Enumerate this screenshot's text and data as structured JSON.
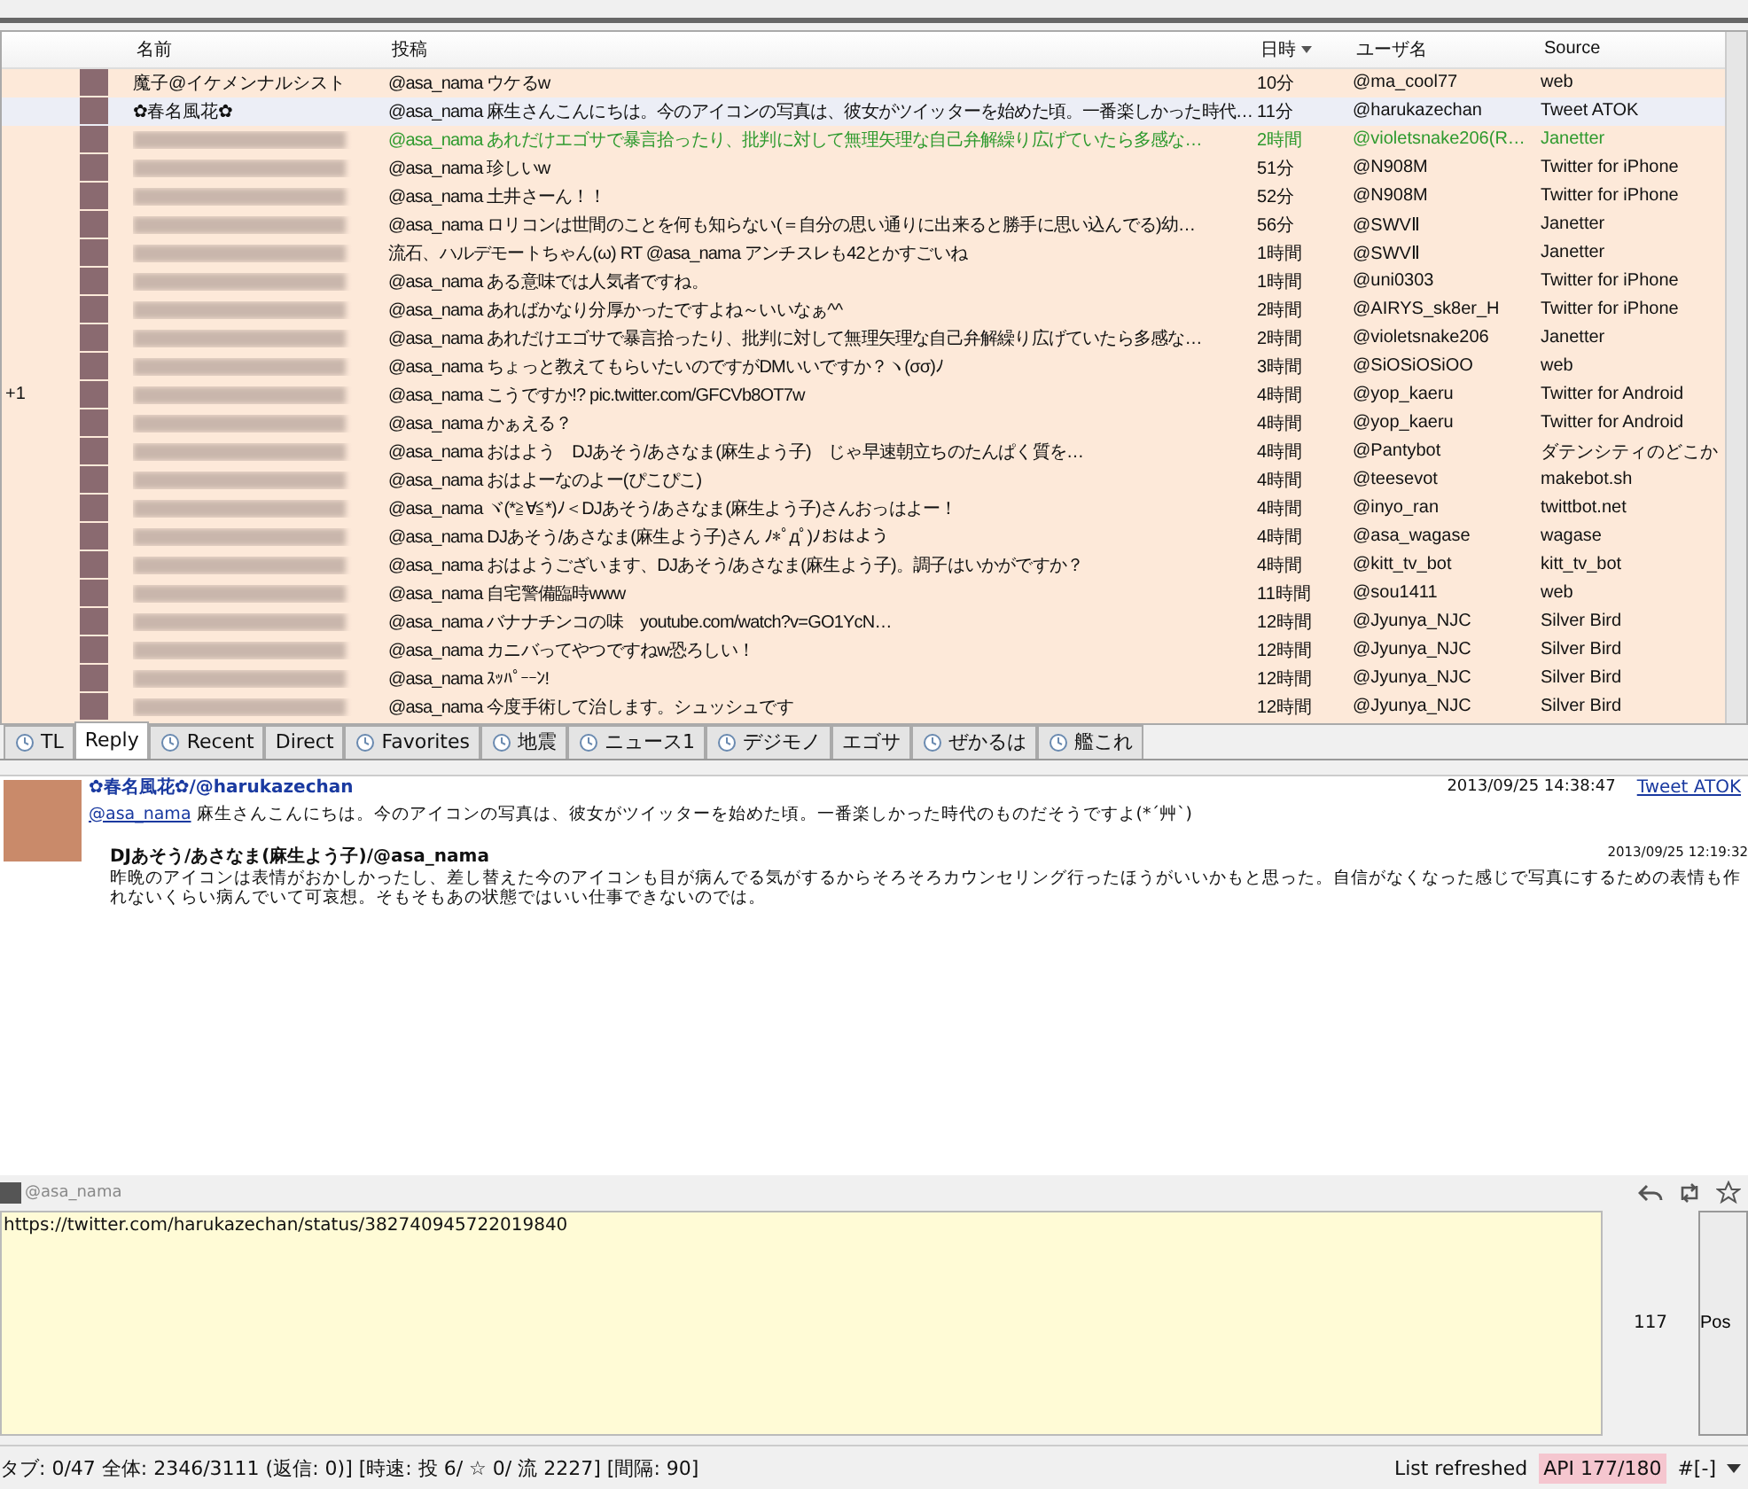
{
  "table": {
    "columns": [
      {
        "label": "名前",
        "sort": false
      },
      {
        "label": "投稿",
        "sort": false
      },
      {
        "label": "日時",
        "sort": true
      },
      {
        "label": "ユーザ名",
        "sort": false
      },
      {
        "label": "Source",
        "sort": false
      }
    ],
    "rows": [
      {
        "mark": "",
        "name": "魔子@イケメンナルシスト",
        "post": "@asa_nama ウケるw",
        "time": "10分",
        "user": "@ma_cool77",
        "source": "web",
        "selected": false,
        "green": false
      },
      {
        "mark": "",
        "name": "✿春名風花✿",
        "post": "@asa_nama 麻生さんこんにちは。今のアイコンの写真は、彼女がツイッターを始めた頃。一番楽しかった時代…",
        "time": "11分",
        "user": "@harukazechan",
        "source": "Tweet ATOK",
        "selected": true,
        "green": false
      },
      {
        "mark": "",
        "post": "@asa_nama あれだけエゴサで暴言拾ったり、批判に対して無理矢理な自己弁解繰り広げていたら多感な…",
        "time": "2時間",
        "user": "@violetsnake206(R…",
        "source": "Janetter",
        "selected": false,
        "green": true
      },
      {
        "mark": "",
        "post": "@asa_nama 珍しいw",
        "time": "51分",
        "user": "@N908M",
        "source": "Twitter for iPhone",
        "selected": false,
        "green": false
      },
      {
        "mark": "",
        "post": "@asa_nama 土井さーん！！",
        "time": "52分",
        "user": "@N908M",
        "source": "Twitter for iPhone",
        "selected": false,
        "green": false
      },
      {
        "mark": "",
        "post": "@asa_nama ロリコンは世間のことを何も知らない(＝自分の思い通りに出来ると勝手に思い込んでる)幼…",
        "time": "56分",
        "user": "@SWVⅡ",
        "source": "Janetter",
        "selected": false,
        "green": false
      },
      {
        "mark": "",
        "post": "流石、ハルデモートちゃん(ω) RT @asa_nama アンチスレも42とかすごいね",
        "time": "1時間",
        "user": "@SWVⅡ",
        "source": "Janetter",
        "selected": false,
        "green": false
      },
      {
        "mark": "",
        "post": "@asa_nama ある意味では人気者ですね。",
        "time": "1時間",
        "user": "@uni0303",
        "source": "Twitter for iPhone",
        "selected": false,
        "green": false
      },
      {
        "mark": "",
        "post": "@asa_nama あればかなり分厚かったですよね～いいなぁ^^",
        "time": "2時間",
        "user": "@AIRYS_sk8er_H",
        "source": "Twitter for iPhone",
        "selected": false,
        "green": false
      },
      {
        "mark": "",
        "post": "@asa_nama あれだけエゴサで暴言拾ったり、批判に対して無理矢理な自己弁解繰り広げていたら多感な…",
        "time": "2時間",
        "user": "@violetsnake206",
        "source": "Janetter",
        "selected": false,
        "green": false
      },
      {
        "mark": "",
        "post": "@asa_nama ちょっと教えてもらいたいのですがDMいいですか？ヽ(σσ)ﾉ",
        "time": "3時間",
        "user": "@SiOSiOSiOO",
        "source": "web",
        "selected": false,
        "green": false
      },
      {
        "mark": "+1",
        "post": "@asa_nama こうですか!? pic.twitter.com/GFCVb8OT7w",
        "time": "4時間",
        "user": "@yop_kaeru",
        "source": "Twitter for Android",
        "selected": false,
        "green": false
      },
      {
        "mark": "",
        "post": "@asa_nama かぁえる？",
        "time": "4時間",
        "user": "@yop_kaeru",
        "source": "Twitter for Android",
        "selected": false,
        "green": false
      },
      {
        "mark": "",
        "post": "@asa_nama おはよう　DJあそう/あさなま(麻生よう子)　じゃ早速朝立ちのたんぱく質を…",
        "time": "4時間",
        "user": "@Pantybot",
        "source": "ダテンシティのどこか",
        "selected": false,
        "green": false
      },
      {
        "mark": "",
        "post": "@asa_nama おはよーなのよー(ぴこぴこ)",
        "time": "4時間",
        "user": "@teesevot",
        "source": "makebot.sh",
        "selected": false,
        "green": false
      },
      {
        "mark": "",
        "post": "@asa_nama ヾ(*≧∀≦*)ﾉ＜DJあそう/あさなま(麻生よう子)さんおっはよー！",
        "time": "4時間",
        "user": "@inyo_ran",
        "source": "twittbot.net",
        "selected": false,
        "green": false
      },
      {
        "mark": "",
        "post": "@asa_nama DJあそう/あさなま(麻生よう子)さん ﾉ*ﾟдﾟ)ﾉおはよう",
        "time": "4時間",
        "user": "@asa_wagase",
        "source": "wagase",
        "selected": false,
        "green": false
      },
      {
        "mark": "",
        "post": "@asa_nama おはようございます、DJあそう/あさなま(麻生よう子)。調子はいかがですか？",
        "time": "4時間",
        "user": "@kitt_tv_bot",
        "source": "kitt_tv_bot",
        "selected": false,
        "green": false
      },
      {
        "mark": "",
        "post": "@asa_nama 自宅警備臨時www",
        "time": "11時間",
        "user": "@sou1411",
        "source": "web",
        "selected": false,
        "green": false
      },
      {
        "mark": "",
        "post": "@asa_nama バナナチンコの味　youtube.com/watch?v=GO1YcN…",
        "time": "12時間",
        "user": "@Jyunya_NJC",
        "source": "Silver Bird",
        "selected": false,
        "green": false
      },
      {
        "mark": "",
        "post": "@asa_nama カニバってやつですねw恐ろしい！",
        "time": "12時間",
        "user": "@Jyunya_NJC",
        "source": "Silver Bird",
        "selected": false,
        "green": false
      },
      {
        "mark": "",
        "post": "@asa_nama ｽｯﾊﾟｰｰﾝ!",
        "time": "12時間",
        "user": "@Jyunya_NJC",
        "source": "Silver Bird",
        "selected": false,
        "green": false
      },
      {
        "mark": "",
        "post": "@asa_nama 今度手術して治します。シュッシュです",
        "time": "12時間",
        "user": "@Jyunya_NJC",
        "source": "Silver Bird",
        "selected": false,
        "green": false
      }
    ]
  },
  "tabs": [
    {
      "label": "TL",
      "icon": true,
      "selected": false
    },
    {
      "label": "Reply",
      "icon": false,
      "selected": true
    },
    {
      "label": "Recent",
      "icon": true,
      "selected": false
    },
    {
      "label": "Direct",
      "icon": false,
      "selected": false
    },
    {
      "label": "Favorites",
      "icon": true,
      "selected": false
    },
    {
      "label": "地震",
      "icon": true,
      "selected": false
    },
    {
      "label": "ニュース1",
      "icon": true,
      "selected": false
    },
    {
      "label": "デジモノ",
      "icon": true,
      "selected": false
    },
    {
      "label": "エゴサ",
      "icon": false,
      "selected": false
    },
    {
      "label": "ぜかるは",
      "icon": true,
      "selected": false
    },
    {
      "label": "艦これ",
      "icon": true,
      "selected": false
    }
  ],
  "detail": {
    "author": "✿春名風花✿/@harukazechan",
    "date": "2013/09/25 14:38:47",
    "source": "Tweet ATOK",
    "mention": "@asa_nama",
    "text": "麻生さんこんにちは。今のアイコンの写真は、彼女がツイッターを始めた頃。一番楽しかった時代のものだそうですよ(*´艸`)",
    "quote": {
      "author": "DJあそう/あさなま(麻生よう子)/@asa_nama",
      "date": "2013/09/25 12:19:32",
      "text": "昨晩のアイコンは表情がおかしかったし、差し替えた今のアイコンも目が病んでる気がするからそろそろカウンセリング行ったほうがいいかもと思った。自信がなくなった感じで写真にするための表情も作れないくらい病んでいて可哀想。そもそもあの状態ではいい仕事できないのでは。"
    }
  },
  "composer": {
    "account": "@asa_nama",
    "value": "https://twitter.com/harukazechan/status/382740945722019840",
    "count": "117",
    "post_button": "Pos"
  },
  "status_bar": {
    "info": "タブ: 0/47 全体: 2346/3111 (返信: 0)] [時速: 投 6/ ☆ 0/ 流 2227] [間隔: 90]",
    "message": "List refreshed",
    "api": "API 177/180",
    "hash": "#[-]"
  }
}
